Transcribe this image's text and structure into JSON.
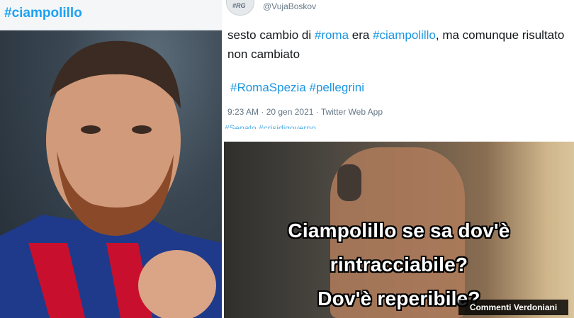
{
  "left_panel": {
    "hashtag": "#ciampolillo"
  },
  "tweet": {
    "avatar_text": "#RG",
    "handle": "@VujaBoskov",
    "text_part1": "sesto cambio di ",
    "text_tag1": "#roma",
    "text_part2": " era ",
    "text_tag2": "#ciampolillo",
    "text_part3": ", ma comunque risultato non cambiato",
    "hashtags": "#RomaSpezia #pellegrini",
    "timestamp": "9:23 AM · 20 gen 2021 · Twitter Web App",
    "partial_hashtags": "#Senato #crisidigoverno"
  },
  "meme": {
    "caption_line1": "Ciampolillo se sa dov'è",
    "caption_line2": "rintracciabile?",
    "caption_line3": "Dov'è reperibile?"
  },
  "watermark": "Commenti Verdoniani",
  "colors": {
    "hashtag_blue": "#1b95e0",
    "tweet_text": "#14171a",
    "meta_gray": "#657786"
  }
}
